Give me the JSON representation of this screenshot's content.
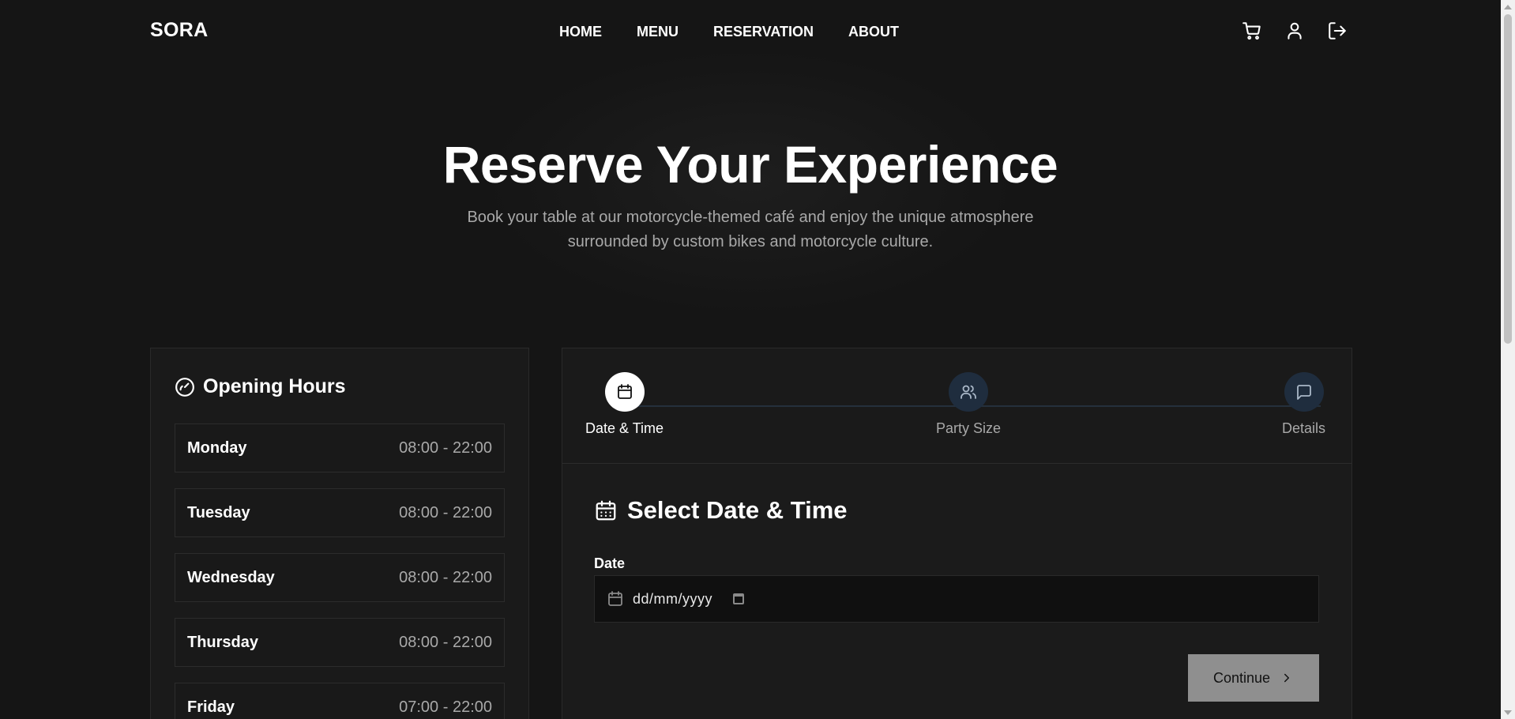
{
  "header": {
    "logo": "SORA",
    "nav": [
      "HOME",
      "MENU",
      "RESERVATION",
      "ABOUT"
    ],
    "icons": [
      "cart-icon",
      "user-icon",
      "logout-icon"
    ]
  },
  "hero": {
    "title": "Reserve Your Experience",
    "subtitle_line1": "Book your table at our motorcycle-themed café and enjoy the unique atmosphere",
    "subtitle_line2": "surrounded by custom bikes and motorcycle culture."
  },
  "hours": {
    "title": "Opening Hours",
    "days": [
      {
        "day": "Monday",
        "time": "08:00 - 22:00"
      },
      {
        "day": "Tuesday",
        "time": "08:00 - 22:00"
      },
      {
        "day": "Wednesday",
        "time": "08:00 - 22:00"
      },
      {
        "day": "Thursday",
        "time": "08:00 - 22:00"
      },
      {
        "day": "Friday",
        "time": "07:00 - 22:00"
      }
    ]
  },
  "reservation": {
    "steps": [
      {
        "label": "Date & Time",
        "icon": "calendar-icon",
        "active": true
      },
      {
        "label": "Party Size",
        "icon": "users-icon",
        "active": false
      },
      {
        "label": "Details",
        "icon": "message-icon",
        "active": false
      }
    ],
    "section_title": "Select Date & Time",
    "date_label": "Date",
    "date_placeholder": "dd/mm/yyyy",
    "continue_label": "Continue"
  },
  "colors": {
    "background": "#151515",
    "card": "#1a1a1a",
    "step_inactive": "#1f2d3e",
    "button": "#8f8f8f",
    "muted_text": "#a9a9a9"
  }
}
